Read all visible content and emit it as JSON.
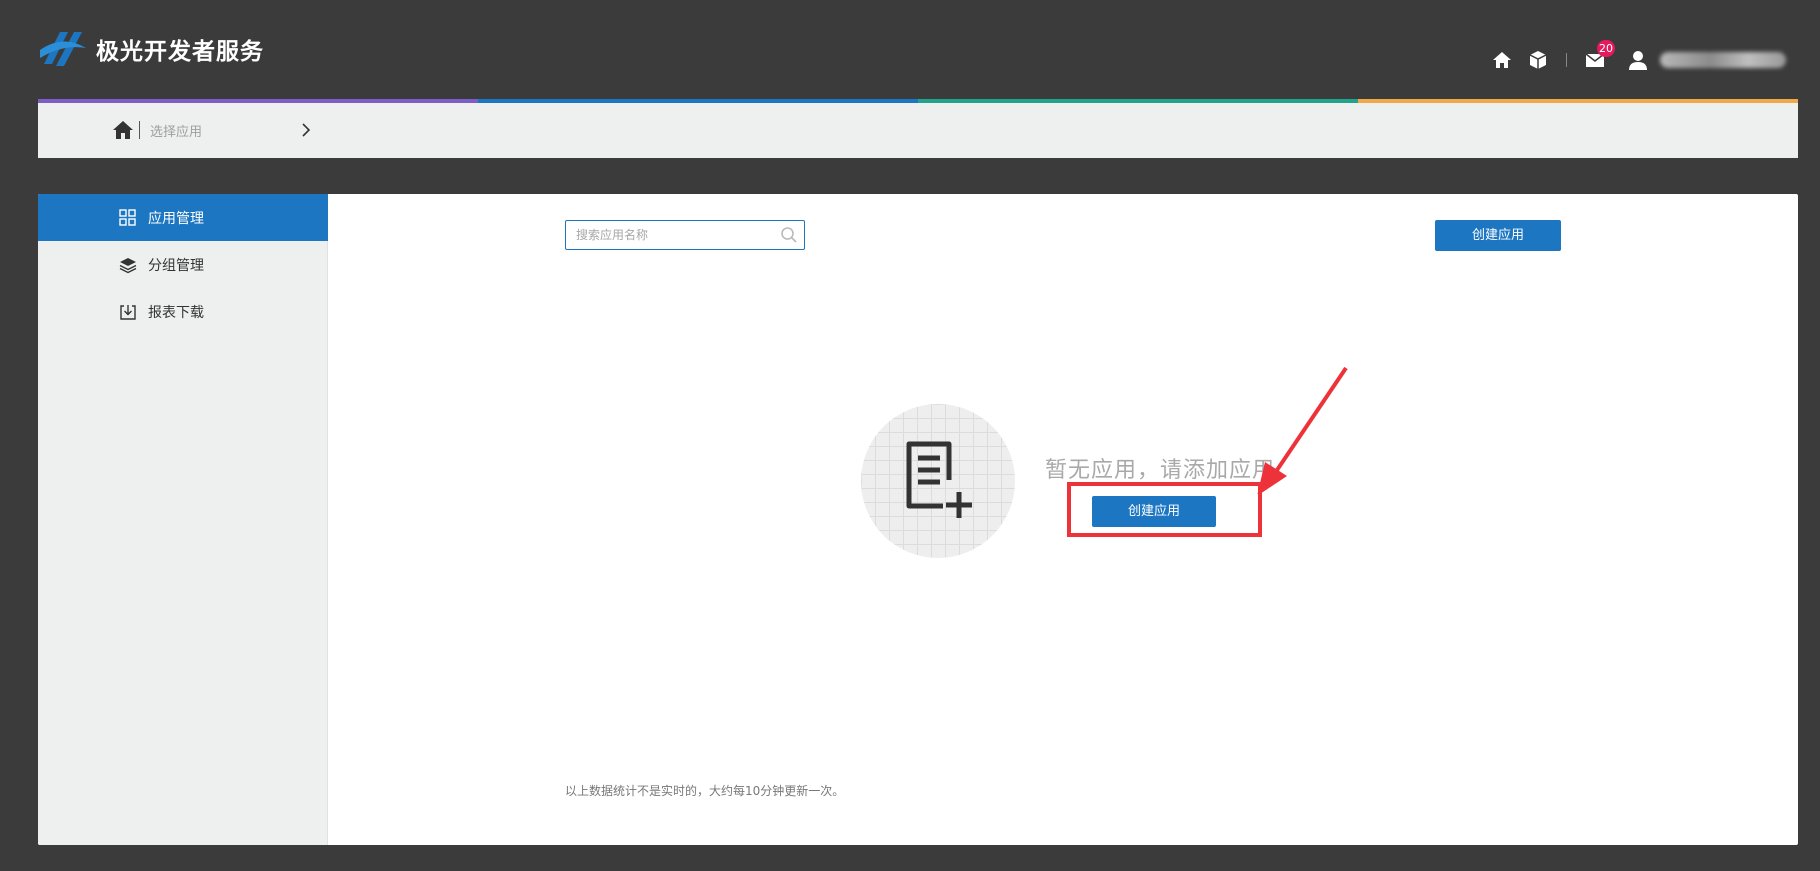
{
  "app": {
    "title": "极光开发者服务"
  },
  "header": {
    "notification_count": "20",
    "colors": {
      "bar": "#3b3b3b",
      "accent": "#1c76c2",
      "badge": "#e5195e"
    }
  },
  "colorline": [
    "#7b5fc7",
    "#1c76c2",
    "#22a38e",
    "#f0a94a"
  ],
  "breadcrumb": {
    "label": "选择应用"
  },
  "sidebar": {
    "items": [
      {
        "label": "应用管理",
        "icon": "grid-icon",
        "active": true
      },
      {
        "label": "分组管理",
        "icon": "layers-icon",
        "active": false
      },
      {
        "label": "报表下载",
        "icon": "download-icon",
        "active": false
      }
    ]
  },
  "main": {
    "search_placeholder": "搜索应用名称",
    "create_button_label": "创建应用",
    "empty_text": "暂无应用，请添加应用",
    "empty_create_label": "创建应用",
    "footnote": "以上数据统计不是实时的，大约每10分钟更新一次。"
  }
}
